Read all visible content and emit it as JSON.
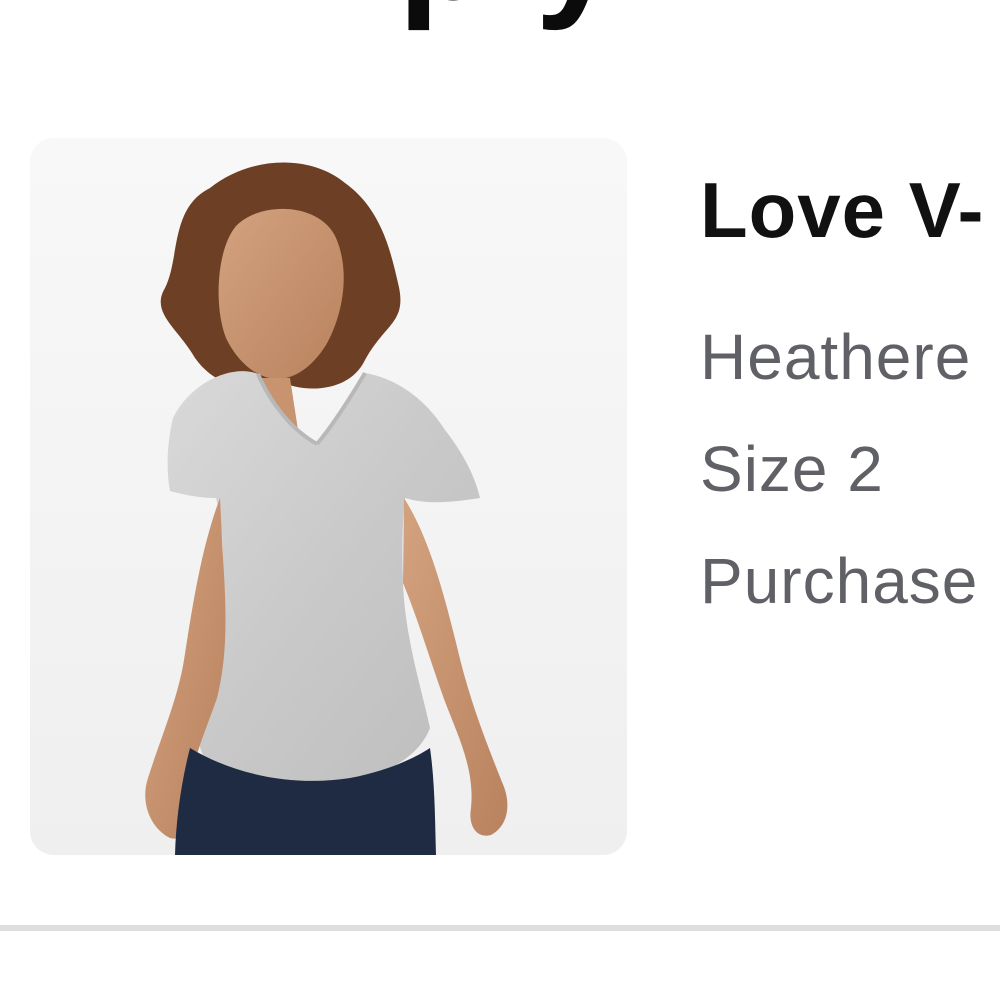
{
  "page": {
    "heading_fragment": "p  y"
  },
  "product": {
    "name": "Love V-",
    "color": "Heathere",
    "size": "Size 2",
    "purchase": "Purchase",
    "image_description": "Person wearing a heathered gray V-neck tee and navy pants"
  },
  "colors": {
    "text_primary": "#111111",
    "text_secondary": "#5f6166",
    "card_background": "#f4f4f4",
    "divider": "#dedede"
  }
}
